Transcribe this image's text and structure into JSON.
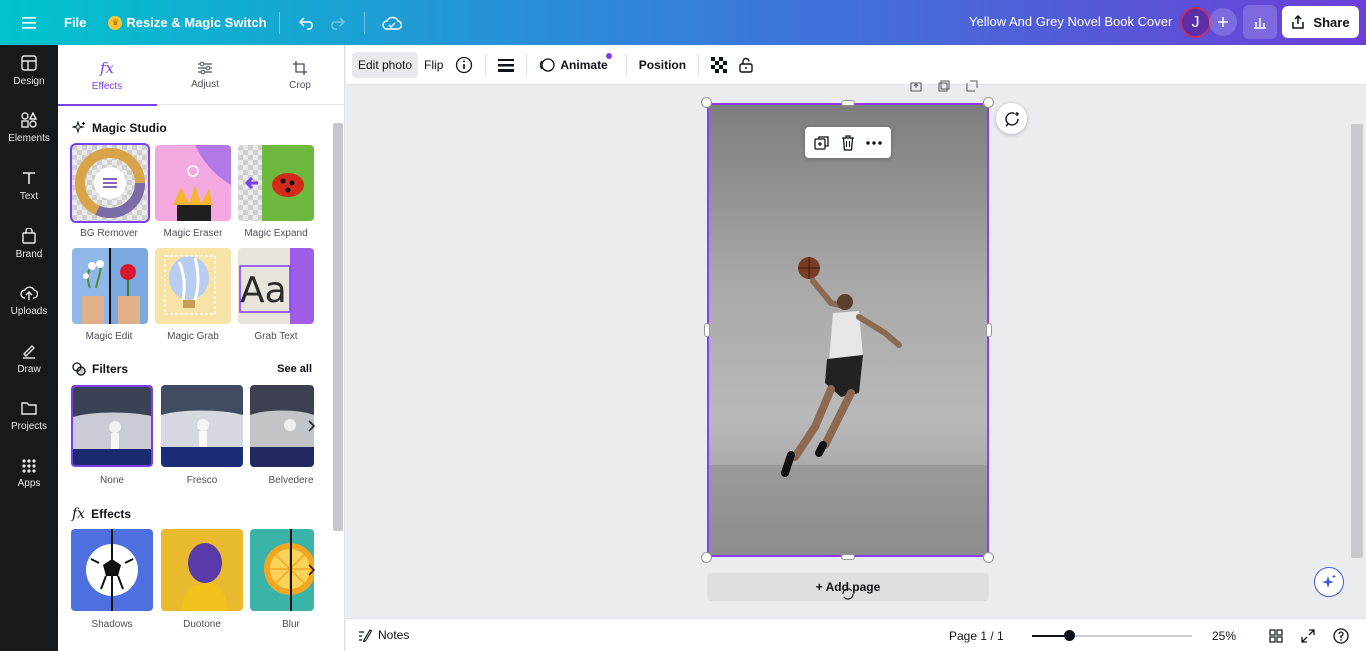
{
  "topbar": {
    "file_label": "File",
    "resize_label": "Resize & Magic Switch",
    "doc_title": "Yellow And Grey Novel Book Cover",
    "avatar_initial": "J",
    "share_label": "Share"
  },
  "rail": {
    "items": [
      {
        "label": "Design",
        "icon": "design-icon"
      },
      {
        "label": "Elements",
        "icon": "elements-icon"
      },
      {
        "label": "Text",
        "icon": "text-icon"
      },
      {
        "label": "Brand",
        "icon": "brand-icon"
      },
      {
        "label": "Uploads",
        "icon": "uploads-icon"
      },
      {
        "label": "Draw",
        "icon": "draw-icon"
      },
      {
        "label": "Projects",
        "icon": "projects-icon"
      },
      {
        "label": "Apps",
        "icon": "apps-icon"
      }
    ]
  },
  "panel": {
    "tabs": [
      {
        "label": "Effects",
        "icon": "fx-icon"
      },
      {
        "label": "Adjust",
        "icon": "sliders-icon"
      },
      {
        "label": "Crop",
        "icon": "crop-icon"
      }
    ],
    "magic_studio": {
      "title": "Magic Studio",
      "tools": [
        {
          "label": "BG Remover"
        },
        {
          "label": "Magic Eraser"
        },
        {
          "label": "Magic Expand"
        },
        {
          "label": "Magic Edit"
        },
        {
          "label": "Magic Grab"
        },
        {
          "label": "Grab Text"
        }
      ]
    },
    "filters": {
      "title": "Filters",
      "see_all": "See all",
      "items": [
        {
          "label": "None"
        },
        {
          "label": "Fresco"
        },
        {
          "label": "Belvedere"
        }
      ]
    },
    "effects": {
      "title": "Effects",
      "items": [
        {
          "label": "Shadows"
        },
        {
          "label": "Duotone"
        },
        {
          "label": "Blur"
        }
      ]
    }
  },
  "toolbar": {
    "edit_photo": "Edit photo",
    "flip": "Flip",
    "animate": "Animate",
    "position": "Position"
  },
  "canvas": {
    "add_page": "+ Add page"
  },
  "bottombar": {
    "notes": "Notes",
    "page_indicator": "Page 1 / 1",
    "zoom_label": "25%",
    "zoom_fraction": 0.23
  },
  "colors": {
    "accent": "#7b3ff2",
    "topbar_start": "#00c4cc",
    "topbar_end": "#6b3fd8"
  }
}
